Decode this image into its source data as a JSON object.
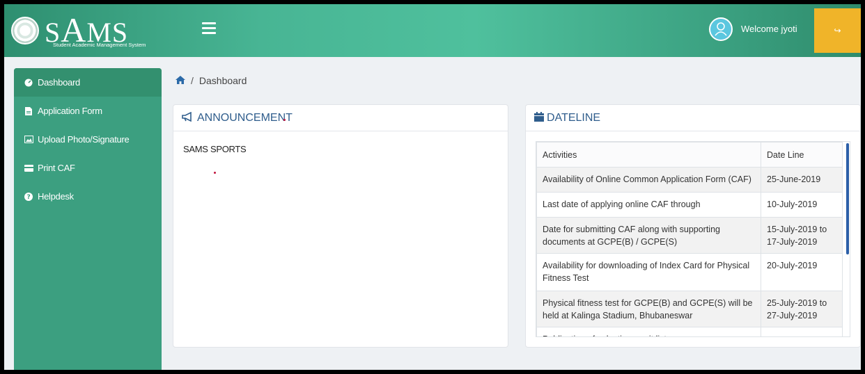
{
  "header": {
    "logo_prefix": "S",
    "logo_big": "A",
    "logo_suffix": "MS",
    "logo_subtitle": "Student Academic Management System",
    "welcome": "Welcome jyoti",
    "logout_icon": "↪"
  },
  "sidebar": {
    "items": [
      {
        "label": "Dashboard",
        "icon": "dashboard-icon"
      },
      {
        "label": "Application Form",
        "icon": "file-icon"
      },
      {
        "label": "Upload Photo/Signature",
        "icon": "image-icon"
      },
      {
        "label": "Print CAF",
        "icon": "card-icon"
      },
      {
        "label": "Helpdesk",
        "icon": "question-icon"
      }
    ]
  },
  "breadcrumb": {
    "separator": "/",
    "current": "Dashboard"
  },
  "announcement": {
    "title": "ANNOUNCEMENT",
    "text": "SAMS SPORTS"
  },
  "dateline": {
    "title": "DATELINE",
    "headers": [
      "Activities",
      "Date Line"
    ],
    "rows": [
      {
        "activity": "Availability of Online Common Application Form (CAF)",
        "date": "25-June-2019"
      },
      {
        "activity": "Last date of applying online CAF through",
        "date": "10-July-2019"
      },
      {
        "activity": "Date for submitting CAF along with supporting documents at GCPE(B) / GCPE(S)",
        "date": "15-July-2019 to 17-July-2019"
      },
      {
        "activity": "Availability for downloading of Index Card for Physical Fitness Test",
        "date": "20-July-2019"
      },
      {
        "activity": "Physical fitness test for GCPE(B) and GCPE(S) will be held at Kalinga Stadium, Bhubaneswar",
        "date": "25-July-2019 to 27-July-2019"
      },
      {
        "activity": "Publication of selection merit list",
        "date": ""
      }
    ]
  },
  "colors": {
    "brand": "#48b594",
    "sidebar": "#3c9f80",
    "accent": "#f0b429",
    "link": "#2f5d8c"
  }
}
